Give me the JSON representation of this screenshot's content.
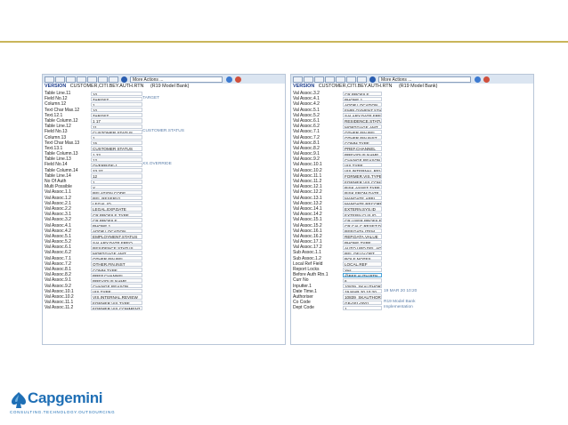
{
  "toolbar": {
    "actions_select": "More Actions ...",
    "colors": {
      "accent": "#2a5db0",
      "cancel": "#d0503c"
    }
  },
  "left": {
    "version_label": "VERSION",
    "version_value": "CUSTOMER,CITI.BEY.AUTH.RTN",
    "version_desc": "(R19 Model Bank)",
    "rows": [
      {
        "label": "Table Line.11",
        "value": "10",
        "desc": ""
      },
      {
        "label": "Field No.12",
        "value": "TARGET",
        "desc": "TARGET"
      },
      {
        "label": "Column.12",
        "value": "1",
        "desc": ""
      },
      {
        "label": "Text Char Max.12",
        "value": "10",
        "desc": ""
      },
      {
        "label": "Text.12.1",
        "value": "TARGET",
        "desc": ""
      },
      {
        "label": "Table Column.12",
        "value": "1 17",
        "desc": ""
      },
      {
        "label": "Table Line.12",
        "value": "11",
        "desc": ""
      },
      {
        "label": "Field No.13",
        "value": "CUSTOMER.STATUS",
        "desc": "CUSTOMER.STATUS"
      },
      {
        "label": "Column.13",
        "value": "1",
        "desc": ""
      },
      {
        "label": "Text Char Max.13",
        "value": "15",
        "desc": ""
      },
      {
        "label": "Text.13.1",
        "value": "CUSTOMER STATUS",
        "desc": ""
      },
      {
        "label": "Table Column.13",
        "value": "1 22",
        "desc": ""
      },
      {
        "label": "Table Line.13",
        "value": "12",
        "desc": ""
      },
      {
        "label": "Field No.14",
        "value": "OVERRIDE-1",
        "desc": "XX.OVERRIDE"
      },
      {
        "label": "Table Column.14",
        "value": "23 37",
        "desc": ""
      },
      {
        "label": "Table Line.14",
        "value": "12",
        "desc": ""
      },
      {
        "label": "No Of Auth",
        "value": "1",
        "desc": ""
      },
      {
        "label": "Multi Possible",
        "value": "Y",
        "desc": ""
      },
      {
        "label": "Val Assoc.1.1",
        "value": "RELATION.CODE",
        "desc": ""
      },
      {
        "label": "Val Assoc.1.2",
        "value": "REL.RESERV1",
        "desc": ""
      },
      {
        "label": "Val Assoc.2.1",
        "value": "LEGAL.ID",
        "desc": ""
      },
      {
        "label": "Val Assoc.2.2",
        "value": "LEGAL.EXP.DATE",
        "desc": ""
      },
      {
        "label": "Val Assoc.3.1",
        "value": "CR.PROFILE.TYPE",
        "desc": ""
      },
      {
        "label": "Val Assoc.3.2",
        "value": "CR.PROFILE",
        "desc": ""
      },
      {
        "label": "Val Assoc.4.1",
        "value": "PHONE.1",
        "desc": ""
      },
      {
        "label": "Val Assoc.4.2",
        "value": "ADDR.LOCATION",
        "desc": ""
      },
      {
        "label": "Val Assoc.5.1",
        "value": "EMPLOYMENT.STATUS",
        "desc": ""
      },
      {
        "label": "Val Assoc.5.2",
        "value": "SALARY.DATE.FREQ",
        "desc": ""
      },
      {
        "label": "Val Assoc.6.1",
        "value": "RESIDENCE.STATUS",
        "desc": ""
      },
      {
        "label": "Val Assoc.6.2",
        "value": "MORTGAGE.AMT",
        "desc": ""
      },
      {
        "label": "Val Assoc.7.1",
        "value": "OTHER.FIN.REL",
        "desc": ""
      },
      {
        "label": "Val Assoc.7.2",
        "value": "OTHER.FIN.INST",
        "desc": ""
      },
      {
        "label": "Val Assoc.8.1",
        "value": "COMM.TYPE",
        "desc": ""
      },
      {
        "label": "Val Assoc.8.2",
        "value": "PREF.CHANNEL",
        "desc": ""
      },
      {
        "label": "Val Assoc.9.1",
        "value": "PREVIOUS.NAME",
        "desc": ""
      },
      {
        "label": "Val Assoc.9.2",
        "value": "CHANGE.REASON",
        "desc": ""
      },
      {
        "label": "Val Assoc.10.1",
        "value": "VIS.TYPE",
        "desc": ""
      },
      {
        "label": "Val Assoc.10.2",
        "value": "VIS.INTERNAL.REVIEW",
        "desc": ""
      },
      {
        "label": "Val Assoc.11.1",
        "value": "FORMER.VIS.TYPE",
        "desc": ""
      },
      {
        "label": "Val Assoc.11.2",
        "value": "FORMER.VIS.COMMENT",
        "desc": ""
      }
    ]
  },
  "right": {
    "version_label": "VERSION",
    "version_value": "CUSTOMER,CITI.BEY.AUTH.RTN",
    "version_desc": "(R19 Model Bank)",
    "rows": [
      {
        "label": "Val Assoc.3.2",
        "value": "CR.PROFILE",
        "desc": ""
      },
      {
        "label": "Val Assoc.4.1",
        "value": "PHONE.1",
        "desc": ""
      },
      {
        "label": "Val Assoc.4.2",
        "value": "ADDR.LOCATION",
        "desc": ""
      },
      {
        "label": "Val Assoc.5.1",
        "value": "EMPLOYMENT.STATUS",
        "desc": ""
      },
      {
        "label": "Val Assoc.5.2",
        "value": "SALARY.DATE.FREQ",
        "desc": ""
      },
      {
        "label": "Val Assoc.6.1",
        "value": "RESIDENCE.STATUS",
        "desc": ""
      },
      {
        "label": "Val Assoc.6.2",
        "value": "MORTGAGE.AMT",
        "desc": ""
      },
      {
        "label": "Val Assoc.7.1",
        "value": "OTHER.FIN.REL",
        "desc": ""
      },
      {
        "label": "Val Assoc.7.2",
        "value": "OTHER.FIN.INST",
        "desc": ""
      },
      {
        "label": "Val Assoc.8.1",
        "value": "COMM.TYPE",
        "desc": ""
      },
      {
        "label": "Val Assoc.8.2",
        "value": "PREF.CHANNEL",
        "desc": ""
      },
      {
        "label": "Val Assoc.9.1",
        "value": "PREVIOUS.NAME",
        "desc": ""
      },
      {
        "label": "Val Assoc.9.2",
        "value": "CHANGE.REASON",
        "desc": ""
      },
      {
        "label": "Val Assoc.10.1",
        "value": "VIS.TYPE",
        "desc": ""
      },
      {
        "label": "Val Assoc.10.2",
        "value": "VIS.INTERNAL.REVIEW",
        "desc": ""
      },
      {
        "label": "Val Assoc.11.1",
        "value": "FORMER.VIS.TYPE",
        "desc": ""
      },
      {
        "label": "Val Assoc.11.2",
        "value": "FORMER.VIS.COMMENT",
        "desc": ""
      },
      {
        "label": "Val Assoc.12.1",
        "value": "RISK.ASSET.TYPE",
        "desc": ""
      },
      {
        "label": "Val Assoc.12.2",
        "value": "RISK.FROM.DATE",
        "desc": ""
      },
      {
        "label": "Val Assoc.13.1",
        "value": "MANDATE.APPL",
        "desc": ""
      },
      {
        "label": "Val Assoc.13.2",
        "value": "MANDATE.RECORD",
        "desc": ""
      },
      {
        "label": "Val Assoc.14.1",
        "value": "EXTERN.SYS.ID",
        "desc": ""
      },
      {
        "label": "Val Assoc.14.2",
        "value": "EXTERN.CUS.ID",
        "desc": ""
      },
      {
        "label": "Val Assoc.15.1",
        "value": "CR.USER.PROFILE.TYPE",
        "desc": ""
      },
      {
        "label": "Val Assoc.15.2",
        "value": "CR.CALC.RESET.DATE",
        "desc": ""
      },
      {
        "label": "Val Assoc.16.1",
        "value": "REP.DATA.ITEM",
        "desc": ""
      },
      {
        "label": "Val Assoc.16.2",
        "value": "REP.DATA.VALUE",
        "desc": ""
      },
      {
        "label": "Val Assoc.17.1",
        "value": "PHONE.TYPE",
        "desc": ""
      },
      {
        "label": "Val Assoc.17.2",
        "value": "AUTO.UPD.DEL.ADD",
        "desc": ""
      },
      {
        "label": "Sub Assoc.1.1",
        "value": "REL.DELIV.OPT",
        "desc": ""
      },
      {
        "label": "Sub Assoc.1.2",
        "value": "ROLE.NOTES",
        "desc": ""
      },
      {
        "label": "Local Ref Field",
        "value": "LOCAL.REF",
        "desc": ""
      },
      {
        "label": "Report Locks",
        "value": "Yes",
        "desc": ""
      },
      {
        "label": "Before Auth Rtn.1",
        "value": "@BEF.AUTH.RTN",
        "desc": "",
        "highlight": true
      },
      {
        "label": "Curr No",
        "value": "6",
        "desc": ""
      },
      {
        "label": "Inputter.1",
        "value": "10839_SKAUTHORISER",
        "desc": ""
      },
      {
        "label": "Date Time.1",
        "value": "19 MAR 20 10:20",
        "desc": "19 MAR 20 10:20"
      },
      {
        "label": "Authoriser",
        "value": "10839_SKAUTHORISER",
        "desc": ""
      },
      {
        "label": "Co Code",
        "value": "GB-001-0001",
        "desc": "R19 Model Bank"
      },
      {
        "label": "Dept Code",
        "value": "1",
        "desc": "Implementation"
      }
    ]
  },
  "logo": {
    "word": "Capgemini",
    "tagline": "CONSULTING.TECHNOLOGY.OUTSOURCING",
    "color": "#1f6fb5"
  }
}
